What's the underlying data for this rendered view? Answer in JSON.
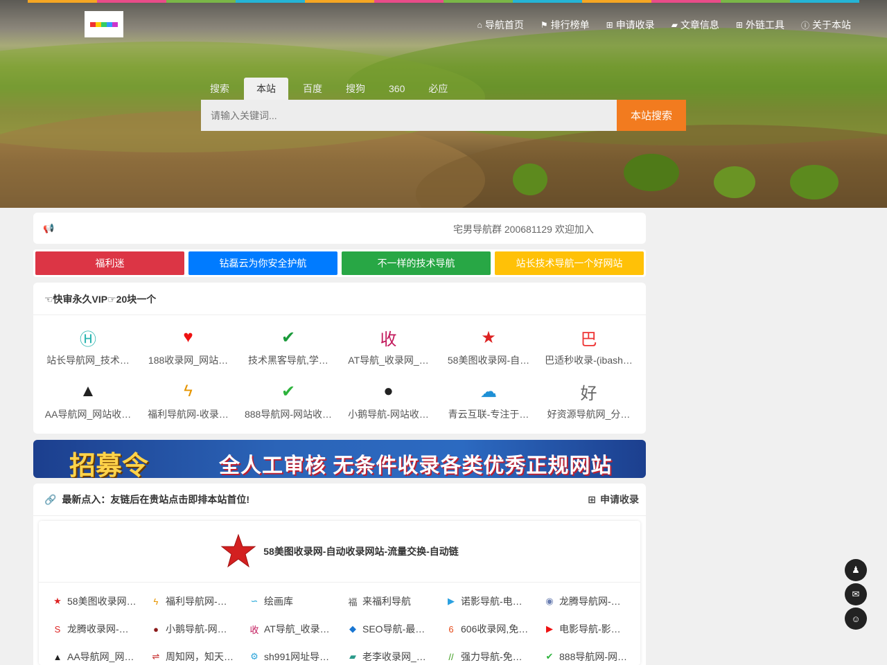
{
  "colors": {
    "accent": "#f27b1f",
    "rainbow": [
      "#f5a623",
      "#e94c89",
      "#7ab648",
      "#25b4d6",
      "#f5a623",
      "#e94c89",
      "#7ab648",
      "#25b4d6",
      "#f5a623",
      "#e94c89",
      "#7ab648",
      "#25b4d6"
    ]
  },
  "nav": [
    {
      "icon": "home-icon",
      "glyph": "⌂",
      "label": "导航首页"
    },
    {
      "icon": "flag-icon",
      "glyph": "⚑",
      "label": "排行榜单"
    },
    {
      "icon": "plus-square-icon",
      "glyph": "⊞",
      "label": "申请收录"
    },
    {
      "icon": "book-icon",
      "glyph": "▰",
      "label": "文章信息"
    },
    {
      "icon": "plus-square-icon",
      "glyph": "⊞",
      "label": "外链工具"
    },
    {
      "icon": "info-icon",
      "glyph": "ⓘ",
      "label": "关于本站"
    }
  ],
  "search": {
    "tabs": [
      "搜索",
      "本站",
      "百度",
      "搜狗",
      "360",
      "必应"
    ],
    "active_tab": 1,
    "placeholder": "请输入关键词...",
    "button": "本站搜索"
  },
  "notice": {
    "text": "宅男导航群 200681129 欢迎加入"
  },
  "color_buttons": [
    {
      "label": "福利迷",
      "color": "#dc3545"
    },
    {
      "label": "钻磊云为你安全护航",
      "color": "#007bff"
    },
    {
      "label": "不一样的技术导航",
      "color": "#28a745"
    },
    {
      "label": "站长技术导航一个好网站",
      "color": "#ffc107"
    }
  ],
  "vip": {
    "title": "☜快审永久VIP☞20块一个",
    "items": [
      {
        "label": "站长导航网_技术…",
        "icon": "h-circle-icon",
        "glyph": "Ⓗ",
        "color": "#2bb5b0"
      },
      {
        "label": "188收录网_网站…",
        "icon": "heart-icon",
        "glyph": "♥",
        "color": "#e11"
      },
      {
        "label": "技术黑客导航,学…",
        "icon": "shield-check-icon",
        "glyph": "✔",
        "color": "#1a9a3a"
      },
      {
        "label": "AT导航_收录网_…",
        "icon": "shou-badge-icon",
        "glyph": "收",
        "color": "#c2185b"
      },
      {
        "label": "58美图收录网-自…",
        "icon": "star-icon",
        "glyph": "★",
        "color": "#d22"
      },
      {
        "label": "巴适秒收录-(ibash…",
        "icon": "basy-logo-icon",
        "glyph": "巴",
        "color": "#e33"
      },
      {
        "label": "AA导航网_网站收…",
        "icon": "aa-logo-icon",
        "glyph": "▲",
        "color": "#222"
      },
      {
        "label": "福利导航网-收录…",
        "icon": "ribbon-icon",
        "glyph": "ϟ",
        "color": "#e69500"
      },
      {
        "label": "888导航网-网站收…",
        "icon": "shield-check-icon",
        "glyph": "✔",
        "color": "#2db33c"
      },
      {
        "label": "小鹅导航-网站收…",
        "icon": "penguin-icon",
        "glyph": "●",
        "color": "#222"
      },
      {
        "label": "青云互联-专注于…",
        "icon": "cloud-icon",
        "glyph": "☁",
        "color": "#1e90d6"
      },
      {
        "label": "好资源导航网_分…",
        "icon": "hao-text-icon",
        "glyph": "好",
        "color": "#666"
      }
    ]
  },
  "banner": {
    "left_text": "招募令",
    "right_text": "全人工审核 无条件收录各类优秀正规网站"
  },
  "latest": {
    "title": "最新点入：友链后在贵站点击即排本站首位!",
    "apply": "申请收录",
    "featured": "58美图收录网-自动收录网站-流量交换-自动链",
    "items": [
      {
        "label": "58美图收录网…",
        "icon": "star-icon",
        "glyph": "★",
        "color": "#d22"
      },
      {
        "label": "福利导航网-…",
        "icon": "ribbon-icon",
        "glyph": "ϟ",
        "color": "#e69500"
      },
      {
        "label": "绘画库",
        "icon": "wave-icon",
        "glyph": "∽",
        "color": "#1aa3d6"
      },
      {
        "label": "来福利导航",
        "icon": "fu-logo-icon",
        "glyph": "福",
        "color": "#555"
      },
      {
        "label": "诺影导航-电…",
        "icon": "play-square-icon",
        "glyph": "▶",
        "color": "#2aa0e0"
      },
      {
        "label": "龙腾导航网-…",
        "icon": "globe-icon",
        "glyph": "◉",
        "color": "#6b7fb2"
      },
      {
        "label": "龙腾收录网-…",
        "icon": "s-logo-icon",
        "glyph": "S",
        "color": "#d22"
      },
      {
        "label": "小鹅导航-网…",
        "icon": "penguin-icon",
        "glyph": "●",
        "color": "#8b1a1a"
      },
      {
        "label": "AT导航_收录…",
        "icon": "shou-badge-icon",
        "glyph": "收",
        "color": "#c2185b"
      },
      {
        "label": "SEO导航-最…",
        "icon": "rocket-icon",
        "glyph": "◆",
        "color": "#1976d2"
      },
      {
        "label": "606收录网,免…",
        "icon": "six-circle-icon",
        "glyph": "6",
        "color": "#e64a19"
      },
      {
        "label": "电影导航-影…",
        "icon": "youtube-icon",
        "glyph": "▶",
        "color": "#e11"
      },
      {
        "label": "AA导航网_网…",
        "icon": "aa-logo-icon",
        "glyph": "▲",
        "color": "#222"
      },
      {
        "label": "周知网，知天…",
        "icon": "zhou-logo-icon",
        "glyph": "⇌",
        "color": "#c62828"
      },
      {
        "label": "sh991网址导…",
        "icon": "gear-icon",
        "glyph": "⚙",
        "color": "#29a3d9"
      },
      {
        "label": "老李收录网_…",
        "icon": "book-icon",
        "glyph": "▰",
        "color": "#2a9a8a"
      },
      {
        "label": "强力导航-免…",
        "icon": "ql-logo-icon",
        "glyph": "//",
        "color": "#3a9a1a"
      },
      {
        "label": "888导航网-网…",
        "icon": "shield-check-icon",
        "glyph": "✔",
        "color": "#2db33c"
      }
    ]
  },
  "float_buttons": [
    {
      "icon": "qq-icon",
      "glyph": "♟"
    },
    {
      "icon": "mail-icon",
      "glyph": "✉"
    },
    {
      "icon": "wechat-icon",
      "glyph": "☺"
    }
  ]
}
